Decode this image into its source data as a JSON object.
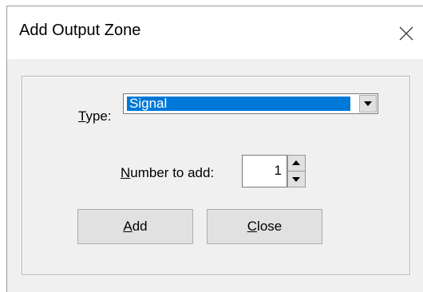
{
  "dialog": {
    "title": "Add Output Zone",
    "type_label_u": "T",
    "type_label_rest": "ype:",
    "type_value": "Signal",
    "number_label_u": "N",
    "number_label_rest": "umber to add:",
    "number_value": "1",
    "add_u": "A",
    "add_rest": "dd",
    "close_u": "C",
    "close_rest": "lose"
  }
}
